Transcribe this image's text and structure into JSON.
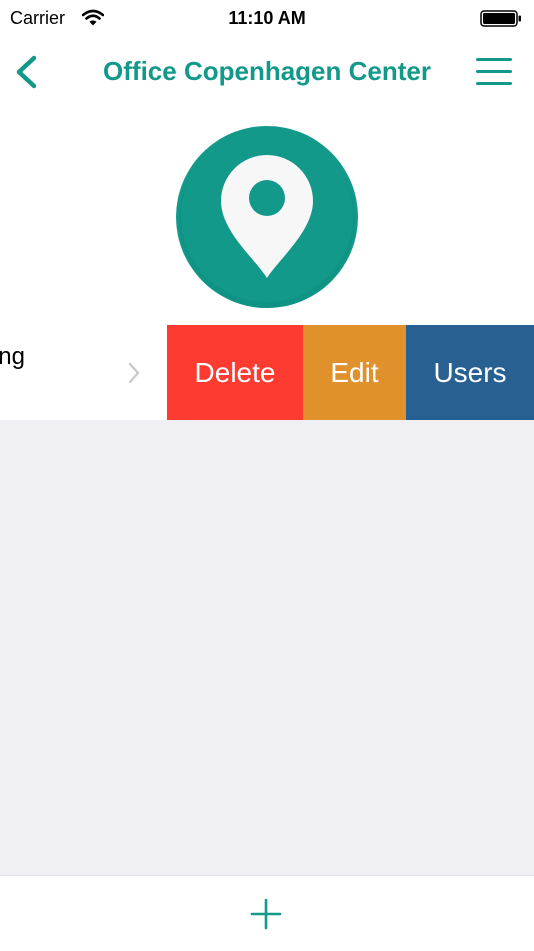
{
  "status_bar": {
    "carrier": "Carrier",
    "time": "11:10 AM",
    "wifi_icon": "wifi-icon",
    "battery_icon": "battery-icon"
  },
  "nav": {
    "title": "Office Copenhagen Center",
    "back_icon": "chevron-left-icon",
    "menu_icon": "hamburger-menu-icon"
  },
  "header": {
    "avatar_icon": "location-pin-icon"
  },
  "row": {
    "label": "Meeting",
    "chevron_icon": "chevron-right-icon",
    "actions": {
      "delete": "Delete",
      "edit": "Edit",
      "users": "Users"
    }
  },
  "bottom_bar": {
    "add_icon": "plus-icon"
  },
  "colors": {
    "accent": "#13998a",
    "delete": "#fe3b30",
    "edit": "#e0912b",
    "users": "#286092",
    "background": "#efeff4"
  }
}
